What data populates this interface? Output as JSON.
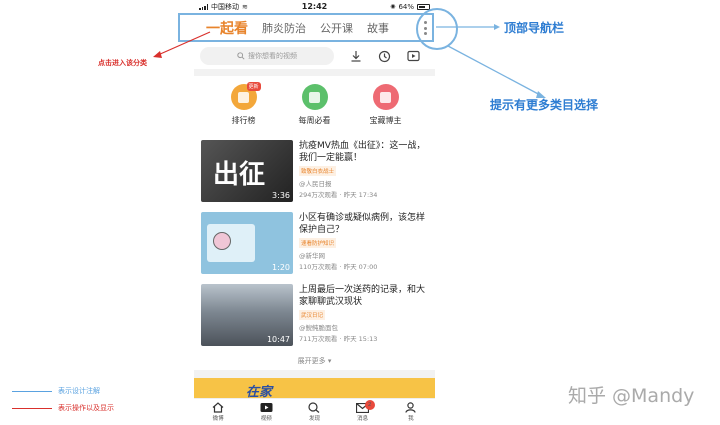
{
  "statusbar": {
    "carrier": "中国移动",
    "time": "12:42",
    "battery": "64%"
  },
  "topnav": {
    "tabs": [
      {
        "label": "一起看",
        "active": true
      },
      {
        "label": "肺炎防治",
        "active": false
      },
      {
        "label": "公开课",
        "active": false
      },
      {
        "label": "故事",
        "active": false
      }
    ]
  },
  "search": {
    "placeholder": "搜你想看的视频"
  },
  "quick": [
    {
      "label": "排行榜",
      "color": "#f3a73a",
      "badge": "更新"
    },
    {
      "label": "每周必看",
      "color": "#5cc06b",
      "badge": ""
    },
    {
      "label": "宝藏博主",
      "color": "#ee6a73",
      "badge": ""
    }
  ],
  "videos": [
    {
      "title": "抗疫MV热血《出征》：这一战，我们一定能赢！",
      "tag": "致敬白衣战士",
      "source": "@人民日报",
      "meta": "294万次观看 · 昨天 17:34",
      "duration": "3:36",
      "thumb_color": "#3a3a3a"
    },
    {
      "title": "小区有确诊或疑似病例，该怎样保护自己？",
      "tag": "速看防护知识",
      "source": "@新华网",
      "meta": "110万次观看 · 昨天 07:00",
      "duration": "1:20",
      "thumb_color": "#8fc3df"
    },
    {
      "title": "上周最后一次送药的记录，和大家聊聊武汉现状",
      "tag": "武汉日记",
      "source": "@鲵鲀脆面包",
      "meta": "711万次观看 · 昨天 15:13",
      "duration": "10:47",
      "thumb_color": "#6d7682"
    }
  ],
  "expand_label": "展开更多",
  "banner_text": "在家",
  "tabbar": [
    {
      "label": "微博",
      "icon": "home-icon"
    },
    {
      "label": "视频",
      "icon": "video-icon"
    },
    {
      "label": "发现",
      "icon": "search-icon"
    },
    {
      "label": "消息",
      "icon": "mail-icon",
      "badge": "2"
    },
    {
      "label": "我",
      "icon": "user-icon"
    }
  ],
  "annotations": {
    "top_nav": "顶部导航栏",
    "more_categories": "提示有更多类目选择",
    "tap_category": "点击进入该分类"
  },
  "legend": [
    {
      "text": "表示设计注解",
      "color": "#5aa2e0"
    },
    {
      "text": "表示操作以及显示",
      "color": "#d9302c"
    }
  ],
  "watermark": "知乎 @Mandy"
}
